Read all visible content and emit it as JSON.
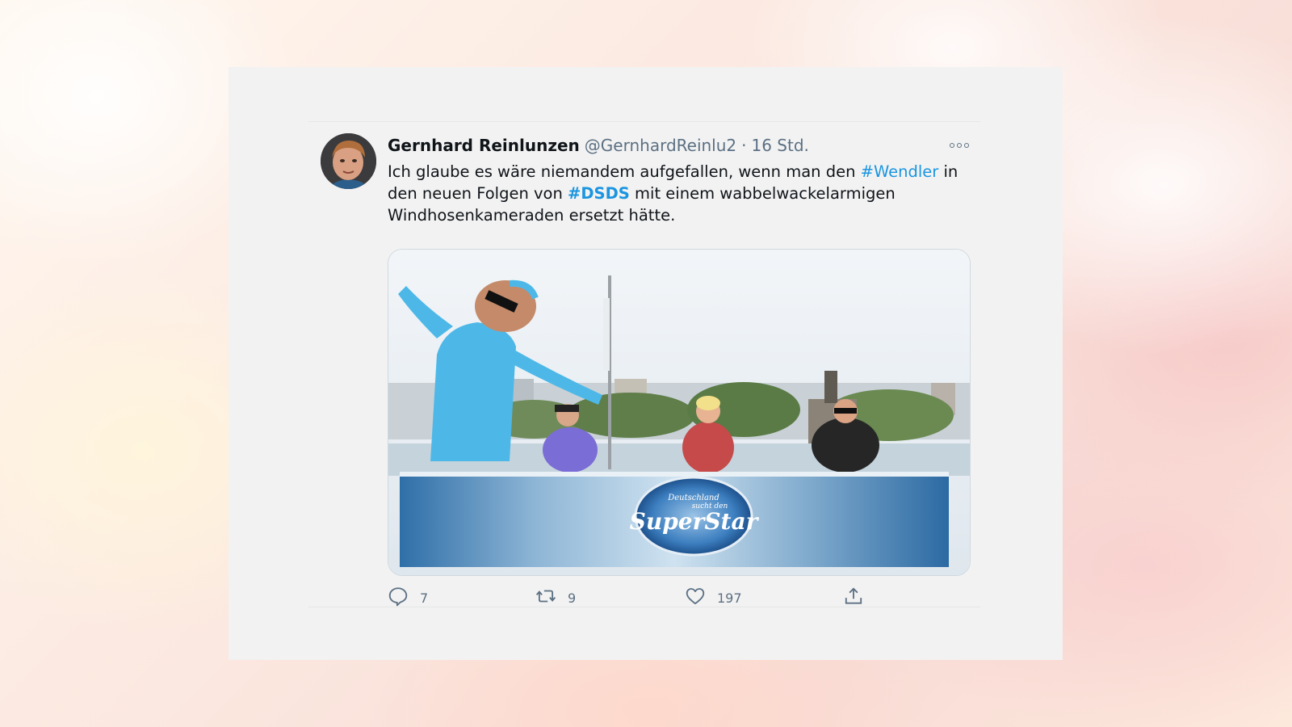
{
  "tweet": {
    "display_name": "Gernhard Reinlunzen",
    "handle": "@GernhardReinlu2",
    "separator": "·",
    "time": "16 Std.",
    "text_part1": "Ich glaube es wäre niemandem aufgefallen, wenn man den ",
    "hashtag1": "#Wendler",
    "text_part2": " in den neuen Folgen von ",
    "hashtag2": "#DSDS",
    "text_part3": " mit einem wabbelwackelarmigen Windhosenkameraden ersetzt hätte.",
    "media_logo_line1": "Deutschland",
    "media_logo_line2": "sucht den",
    "media_logo_main": "SuperStar",
    "actions": {
      "reply_count": "7",
      "retweet_count": "9",
      "like_count": "197"
    }
  },
  "icons": {
    "more": "more-horizontal-icon",
    "reply": "reply-icon",
    "retweet": "retweet-icon",
    "like": "heart-icon",
    "share": "share-icon"
  },
  "colors": {
    "hashtag": "#1b95e0",
    "secondary_text": "#5b7083",
    "panel": "#f2f2f2"
  }
}
